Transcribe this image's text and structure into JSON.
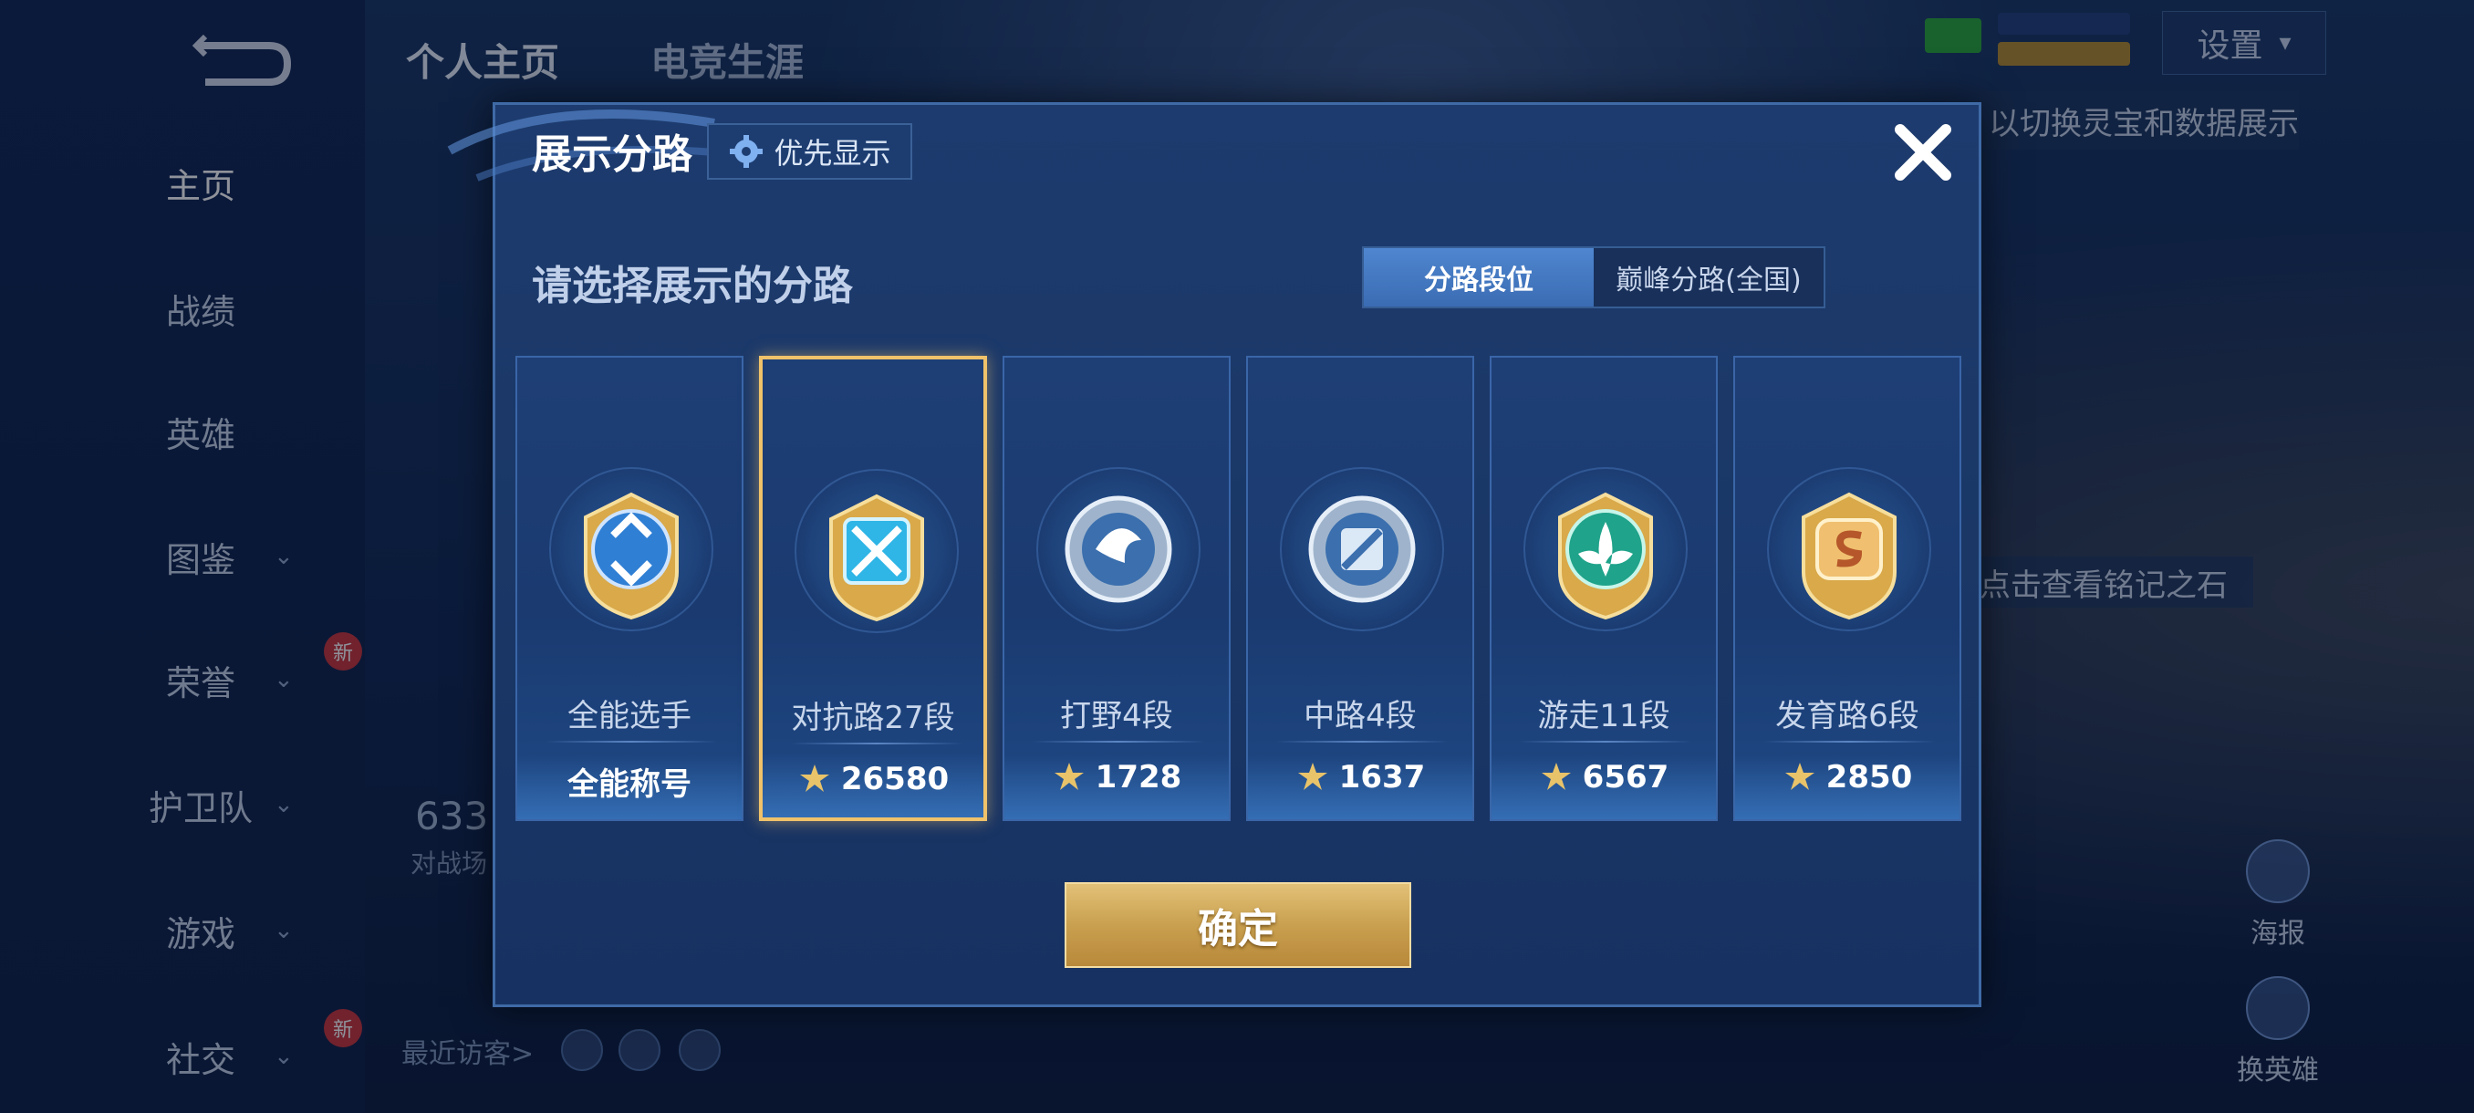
{
  "background": {
    "nav": {
      "items": [
        {
          "label": "主页",
          "icon": "",
          "new": false
        },
        {
          "label": "战绩",
          "icon": "",
          "new": false
        },
        {
          "label": "英雄",
          "icon": "",
          "new": false
        },
        {
          "label": "图鉴",
          "icon": "chevron-down-icon",
          "new": false
        },
        {
          "label": "荣誉",
          "icon": "chevron-down-icon",
          "new": true
        },
        {
          "label": "护卫队",
          "icon": "chevron-down-icon",
          "new": false
        },
        {
          "label": "游戏",
          "icon": "chevron-down-icon",
          "new": false
        },
        {
          "label": "社交",
          "icon": "chevron-down-icon",
          "new": true
        }
      ],
      "new_badge": "新",
      "chevron": "⌄"
    },
    "tabs": [
      "个人主页",
      "电竞生涯"
    ],
    "settings_label": "设置",
    "hint_text": "以切换灵宝和数据展示",
    "rune_hint": "点击查看铭记之石",
    "poster_label": "海报",
    "change_hero_label": "换英雄",
    "stats_value": "633",
    "stats_sub": "对战场",
    "visitors_label": "最近访客>"
  },
  "modal": {
    "title": "展示分路",
    "priority_label": "优先显示",
    "prompt": "请选择展示的分路",
    "toggle": {
      "options": [
        "分路段位",
        "巅峰分路(全国)"
      ],
      "selected": 0
    },
    "cards": [
      {
        "title": "全能选手",
        "value": "全能称号",
        "show_score_icon": false,
        "emblem": "all-round-emblem-icon",
        "selected": false
      },
      {
        "title": "对抗路27段",
        "value": "26580",
        "show_score_icon": true,
        "emblem": "clash-lane-emblem-icon",
        "selected": true
      },
      {
        "title": "打野4段",
        "value": "1728",
        "show_score_icon": true,
        "emblem": "jungle-emblem-icon",
        "selected": false
      },
      {
        "title": "中路4段",
        "value": "1637",
        "show_score_icon": true,
        "emblem": "mid-lane-emblem-icon",
        "selected": false
      },
      {
        "title": "游走11段",
        "value": "6567",
        "show_score_icon": true,
        "emblem": "roam-emblem-icon",
        "selected": false
      },
      {
        "title": "发育路6段",
        "value": "2850",
        "show_score_icon": true,
        "emblem": "farm-lane-emblem-icon",
        "selected": false
      }
    ],
    "confirm_label": "确定",
    "colors": {
      "gold": "#f0c26a",
      "panel": "#1a3766",
      "accent_blue": "#4f86cf"
    }
  }
}
